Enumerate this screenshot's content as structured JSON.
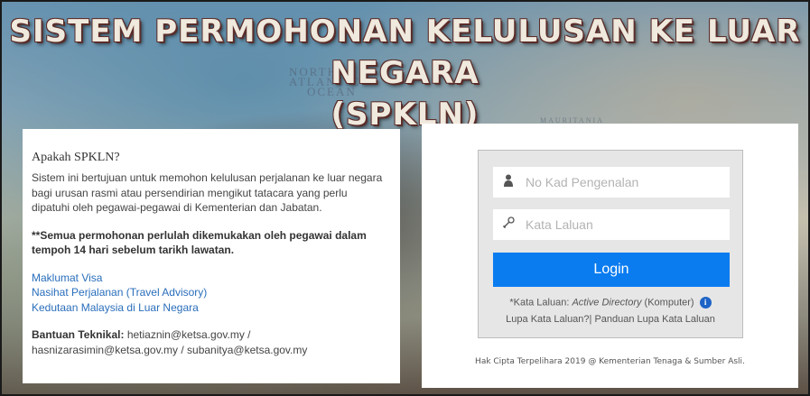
{
  "header": {
    "title_line1": "SISTEM PERMOHONAN KELULUSAN KE LUAR NEGARA",
    "title_line2": "(SPKLN)"
  },
  "background_map_text": [
    "NORTH",
    "ATLANTIC",
    "OCEAN",
    "MAURITANIA"
  ],
  "info_panel": {
    "heading": "Apakah SPKLN?",
    "description": "Sistem ini bertujuan untuk memohon kelulusan perjalanan ke luar negara bagi urusan rasmi atau persendirian mengikut tatacara yang perlu dipatuhi oleh pegawai-pegawai di Kementerian dan Jabatan.",
    "note": "**Semua permohonan perlulah dikemukakan oleh pegawai dalam tempoh 14 hari sebelum tarikh lawatan.",
    "links": [
      "Maklumat Visa",
      "Nasihat Perjalanan (Travel Advisory)",
      "Kedutaan Malaysia di Luar Negara"
    ],
    "help_label": "Bantuan Teknikal:",
    "help_contacts": "hetiaznin@ketsa.gov.my / hasnizarasimin@ketsa.gov.my / subanitya@ketsa.gov.my"
  },
  "login": {
    "id_placeholder": "No Kad Pengenalan",
    "id_value": "",
    "password_placeholder": "Kata Laluan",
    "password_value": "",
    "button_label": "Login",
    "hint_prefix": "*Kata Laluan: ",
    "hint_italic": "Active Directory",
    "hint_suffix": " (Komputer)",
    "forgot_link": "Lupa Kata Laluan?",
    "separator": "|",
    "guide_link": " Panduan Lupa Kata Laluan",
    "copyright": "Hak Cipta Terpelihara 2019 @ Kementerian Tenaga & Sumber Asli."
  },
  "icons": {
    "user": "user-icon",
    "password": "key-icon",
    "info": "info-icon"
  },
  "colors": {
    "login_button": "#0a7cf0",
    "link": "#2a6ebb",
    "title_text": "#f0e9dd",
    "title_outline": "#5a2d2a"
  }
}
